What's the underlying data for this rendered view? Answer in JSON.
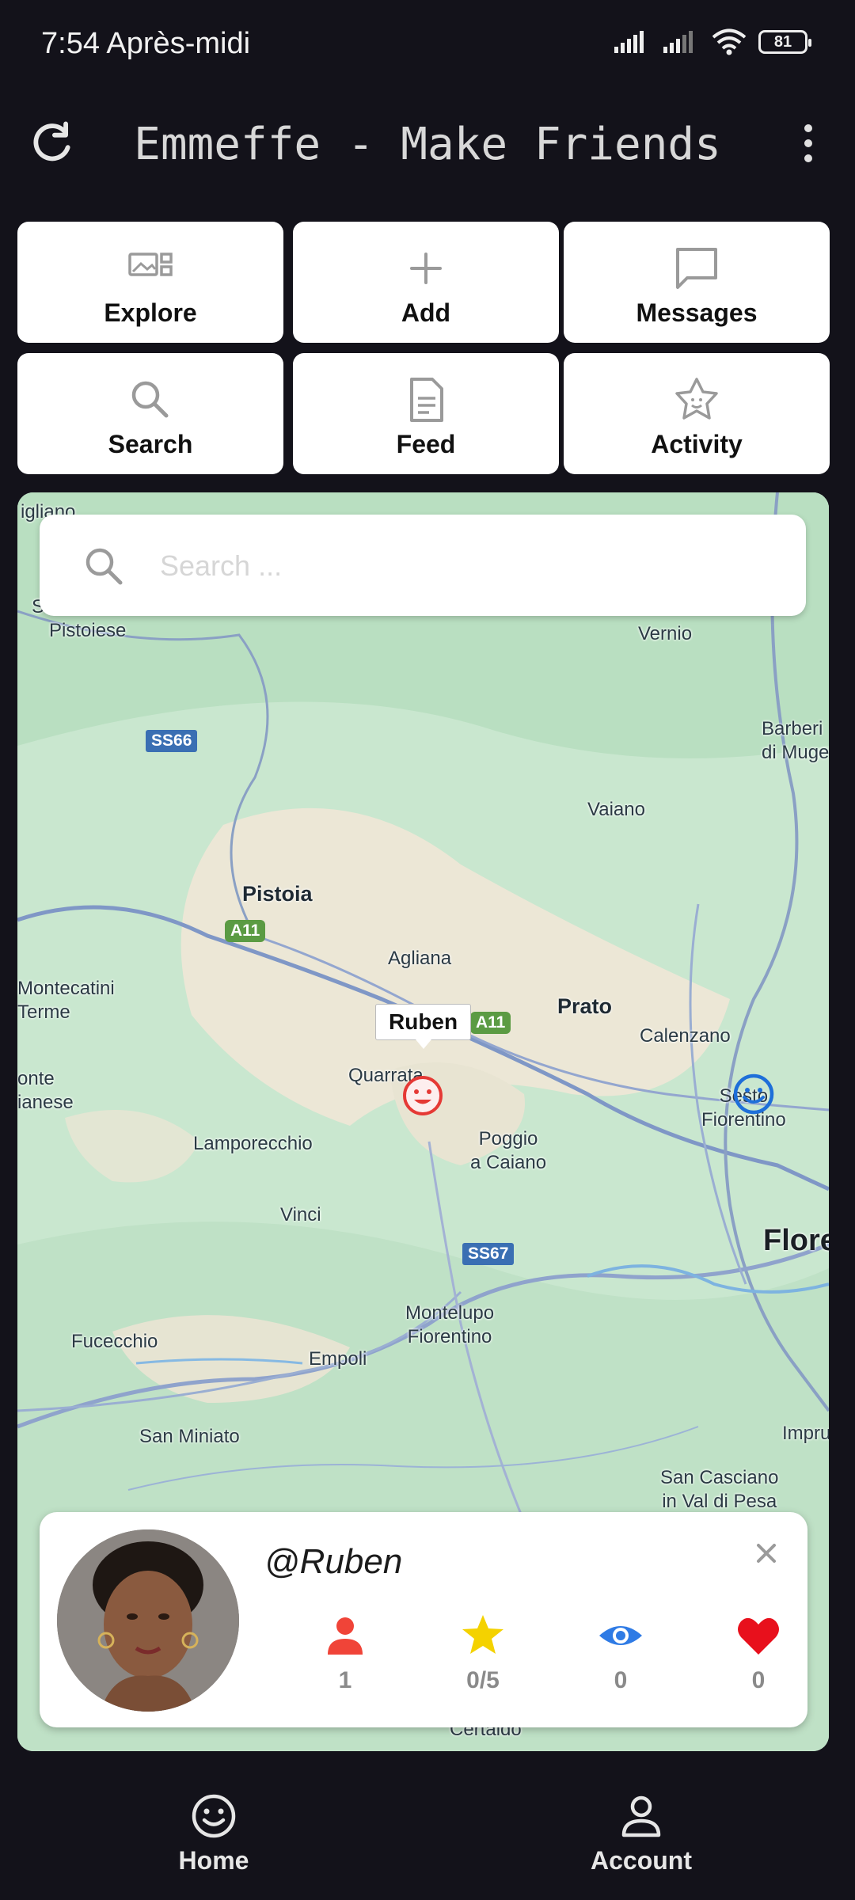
{
  "status_bar": {
    "time": "7:54 Après-midi",
    "battery": "81",
    "icons": [
      "signal-icon",
      "signal-icon",
      "wifi-icon",
      "battery-icon"
    ]
  },
  "app_bar": {
    "title": "Emmeffe - Make Friends",
    "left_icon": "refresh-icon",
    "right_icon": "more-vert-icon"
  },
  "menu": [
    {
      "label": "Explore",
      "icon": "gallery-icon"
    },
    {
      "label": "Add",
      "icon": "plus-icon"
    },
    {
      "label": "Messages",
      "icon": "chat-icon"
    },
    {
      "label": "Search",
      "icon": "search-icon"
    },
    {
      "label": "Feed",
      "icon": "document-icon"
    },
    {
      "label": "Activity",
      "icon": "star-badge-icon"
    }
  ],
  "map": {
    "search_placeholder": "Search ...",
    "places": {
      "castiglione": "igliano",
      "s_letter": "S",
      "pistoiese": "Pistoiese",
      "vernio": "Vernio",
      "barberino": "Barberi\ndi Muge",
      "vaiano": "Vaiano",
      "pistoia": "Pistoia",
      "agliana": "Agliana",
      "montecatini": "Montecatini\nTerme",
      "prato": "Prato",
      "calenzano": "Calenzano",
      "quarrata": "Quarrata",
      "monte": "onte\nianese",
      "sesto": "Sesto\nFiorentino",
      "lamporecchio": "Lamporecchio",
      "poggio": "Poggio\na Caiano",
      "vinci": "Vinci",
      "firenze": "Flore",
      "montelupo": "Montelupo\nFiorentino",
      "fucecchio": "Fucecchio",
      "empoli": "Empoli",
      "san_miniato": "San Miniato",
      "impruneta": "Impru",
      "san_casciano": "San Casciano\nin Val di Pesa",
      "certaldo": "Certaldo"
    },
    "road_shields": {
      "ss66": "SS66",
      "a11_west": "A11",
      "a11_east": "A11",
      "ss67": "SS67"
    },
    "marker_label": "Ruben",
    "colors": {
      "user_marker": "#e53935",
      "other_marker": "#1e6fd9"
    }
  },
  "profile": {
    "username": "@Ruben",
    "stats": [
      {
        "icon": "person-icon",
        "value": "1",
        "color": "#f04438"
      },
      {
        "icon": "star-icon",
        "value": "0/5",
        "color": "#f4d200"
      },
      {
        "icon": "eye-icon",
        "value": "0",
        "color": "#2f7be5"
      },
      {
        "icon": "heart-icon",
        "value": "0",
        "color": "#e8101c"
      }
    ]
  },
  "bottom_nav": [
    {
      "label": "Home",
      "icon": "smiley-icon"
    },
    {
      "label": "Account",
      "icon": "person-outline-icon"
    }
  ]
}
